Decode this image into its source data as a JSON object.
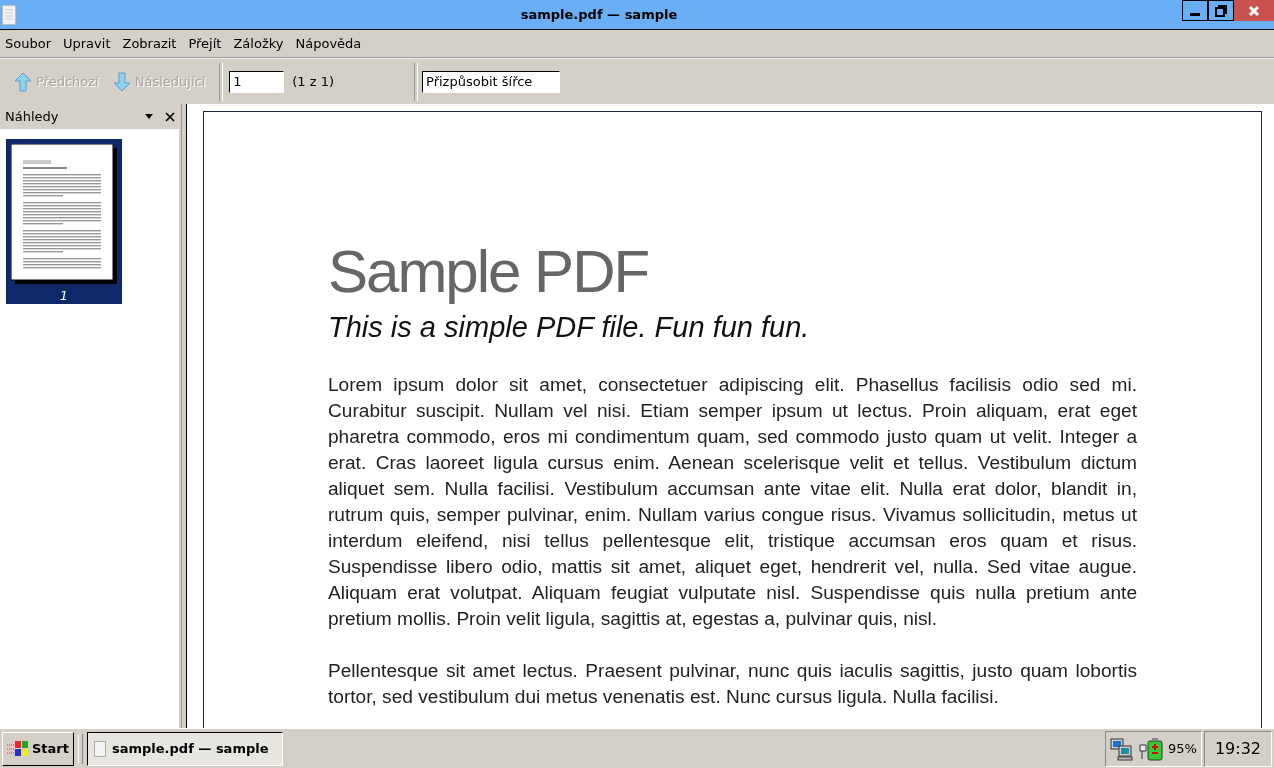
{
  "window": {
    "title": "sample.pdf — sample"
  },
  "menu": [
    "Soubor",
    "Upravit",
    "Zobrazit",
    "Přejít",
    "Záložky",
    "Nápověda"
  ],
  "toolbar": {
    "buttons": [
      {
        "label": "Předchozí",
        "kind": "up",
        "disabled": true
      },
      {
        "label": "Následující",
        "kind": "down",
        "disabled": true
      }
    ],
    "page_field": {
      "value": "1"
    },
    "page_count": "(1 z 1)",
    "zoom_field": {
      "value": "Přizpůsobit šířce"
    }
  },
  "sidebar": {
    "title": "Náhledy",
    "thumbnails": [
      {
        "label": "1",
        "selected": true
      }
    ]
  },
  "document": {
    "title": "Sample PDF",
    "subtitle": "This is a simple PDF file. Fun fun fun.",
    "paragraphs": [
      "Lorem ipsum dolor sit amet, consectetuer adipiscing elit. Phasellus facilisis odio sed mi. Curabitur suscipit. Nullam vel nisi. Etiam semper ipsum ut lectus. Proin aliquam, erat eget pharetra commodo, eros mi condimentum quam, sed commodo justo quam ut velit. Integer a erat. Cras laoreet ligula cursus enim. Aenean scelerisque velit et tellus. Vestibulum dictum aliquet sem. Nulla facilisi. Vestibulum accumsan ante vitae elit. Nulla erat dolor, blandit in, rutrum quis, semper pulvinar, enim. Nullam varius congue risus. Vivamus sollicitudin, metus ut interdum eleifend, nisi tellus pellentesque elit, tristique accumsan eros quam et risus. Suspendisse libero odio, mattis sit amet, aliquet eget, hendrerit vel, nulla. Sed vitae augue. Aliquam erat volutpat. Aliquam feugiat vulputate nisl. Suspendisse quis nulla pretium ante pretium mollis. Proin velit ligula, sagittis at, egestas a, pulvinar quis, nisl.",
      "Pellentesque sit amet lectus. Praesent pulvinar, nunc quis iaculis sagittis, justo quam lobortis tortor, sed vestibulum dui metus venenatis est. Nunc cursus ligula. Nulla facilisi."
    ]
  },
  "taskbar": {
    "start": "Start",
    "tasks": [
      {
        "label": "sample.pdf — sample",
        "selected": true
      }
    ],
    "battery": "95%",
    "clock": "19:32"
  }
}
